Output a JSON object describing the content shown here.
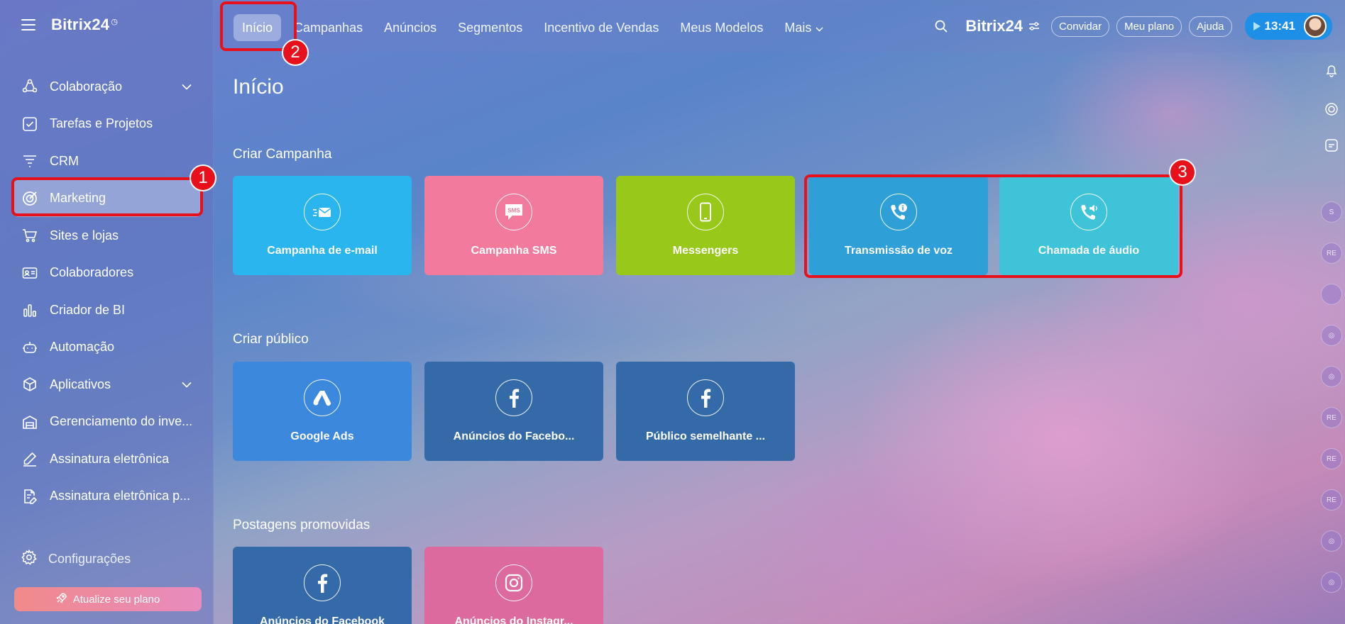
{
  "colors": {
    "email": "#2bb5ee",
    "sms": "#f27a9c",
    "messengers": "#98c81a",
    "voice": "#2f9fd8",
    "audio": "#3ec3d8",
    "google": "#3c88dc",
    "facebook": "#356aa8",
    "instagram": "#dd6a9f",
    "highlight": "#e8101a"
  },
  "sidebar": {
    "logo": "Bitrix24",
    "items": [
      {
        "label": "Colaboração",
        "icon": "collaboration-icon",
        "chevron": true
      },
      {
        "label": "Tarefas e Projetos",
        "icon": "tasks-icon"
      },
      {
        "label": "CRM",
        "icon": "crm-icon"
      },
      {
        "label": "Marketing",
        "icon": "marketing-icon",
        "active": true
      },
      {
        "label": "Sites e lojas",
        "icon": "cart-icon"
      },
      {
        "label": "Colaboradores",
        "icon": "employees-icon"
      },
      {
        "label": "Criador de BI",
        "icon": "bi-chart-icon"
      },
      {
        "label": "Automação",
        "icon": "robot-icon"
      },
      {
        "label": "Aplicativos",
        "icon": "apps-icon",
        "chevron": true
      },
      {
        "label": "Gerenciamento do inve...",
        "icon": "inventory-icon"
      },
      {
        "label": "Assinatura eletrônica",
        "icon": "signature-icon"
      },
      {
        "label": "Assinatura eletrônica p...",
        "icon": "signature-doc-icon"
      }
    ],
    "settings": "Configurações",
    "upgrade": "Atualize seu plano"
  },
  "topbar": {
    "tabs": [
      "Início",
      "Campanhas",
      "Anúncios",
      "Segmentos",
      "Incentivo de Vendas",
      "Meus Modelos",
      "Mais"
    ],
    "brand": "Bitrix24",
    "invite": "Convidar",
    "plan": "Meu plano",
    "help": "Ajuda",
    "time": "13:41"
  },
  "rail": [
    "S",
    "RE",
    "RE",
    "RE",
    "RE"
  ],
  "badges": [
    "1",
    "2",
    "3"
  ],
  "main": {
    "title": "Início",
    "sections": [
      {
        "title": "Criar Campanha",
        "cards": [
          {
            "label": "Campanha de e-mail",
            "icon": "email-icon"
          },
          {
            "label": "Campanha SMS",
            "icon": "sms-icon"
          },
          {
            "label": "Messengers",
            "icon": "phone-icon"
          },
          {
            "label": "Transmissão de voz",
            "icon": "voice-call-icon"
          },
          {
            "label": "Chamada de áudio",
            "icon": "audio-call-icon"
          }
        ]
      },
      {
        "title": "Criar público",
        "cards": [
          {
            "label": "Google Ads",
            "icon": "google-ads-icon"
          },
          {
            "label": "Anúncios do Facebo...",
            "icon": "facebook-icon"
          },
          {
            "label": "Público semelhante ...",
            "icon": "facebook-icon"
          }
        ]
      },
      {
        "title": "Postagens promovidas",
        "cards": [
          {
            "label": "Anúncios do Facebook",
            "icon": "facebook-icon"
          },
          {
            "label": "Anúncios do Instagr...",
            "icon": "instagram-icon"
          }
        ]
      }
    ]
  }
}
